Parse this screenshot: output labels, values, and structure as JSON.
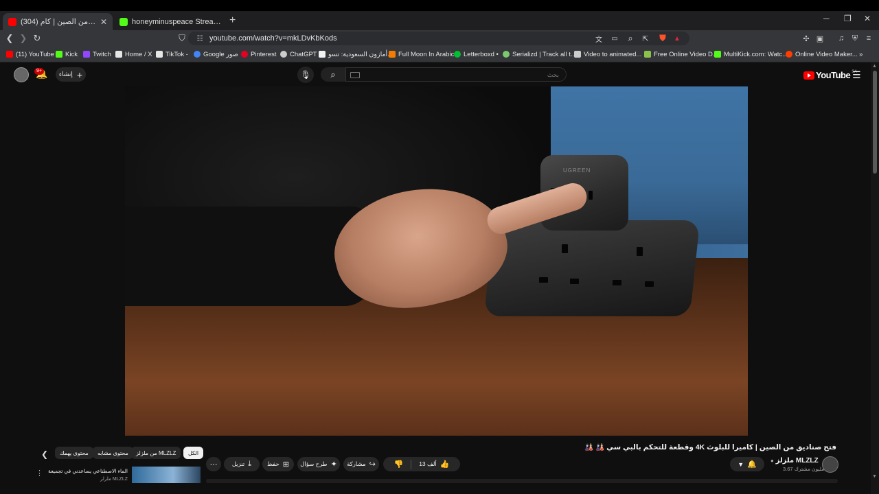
{
  "browser": {
    "tabs": [
      {
        "title": "فتح صناديق من الصين | كام (304)",
        "favicon_color": "#ff0000",
        "active": true
      },
      {
        "title": "honeyminuspeace Stream - Kick Dash",
        "favicon_color": "#53fc18",
        "active": false
      }
    ],
    "new_tab_label": "+",
    "url": "youtube.com/watch?v=mkLDvKbKods",
    "bookmarks": [
      {
        "label": "(11) YouTube",
        "color": "#ff0000"
      },
      {
        "label": "Kick",
        "color": "#53fc18"
      },
      {
        "label": "Twitch",
        "color": "#9146ff"
      },
      {
        "label": "Home / X",
        "color": "#e6e6e6"
      },
      {
        "label": "TikTok -",
        "color": "#e6e6e6"
      },
      {
        "label": "Google صور",
        "color": "#4285f4"
      },
      {
        "label": "Pinterest",
        "color": "#e60023"
      },
      {
        "label": "ChatGPT",
        "color": "#cccccc"
      },
      {
        "label": "أمازون السعودية: تسو...",
        "color": "#f2f2f2"
      },
      {
        "label": "Full Moon In Arabic",
        "color": "#f57c00"
      },
      {
        "label": "Letterboxd •",
        "color": "#00c030"
      },
      {
        "label": "Serializd | Track all t...",
        "color": "#7bc96f"
      },
      {
        "label": "Video to animated...",
        "color": "#cccccc"
      },
      {
        "label": "Free Online Video D...",
        "color": "#8bc34a"
      },
      {
        "label": "MultiKick.com: Watc...",
        "color": "#53fc18"
      },
      {
        "label": "Online Video Maker...",
        "color": "#ff3d00"
      }
    ]
  },
  "yt": {
    "logo_text": "YouTube",
    "logo_region": "SA",
    "search_placeholder": "بحث",
    "create_label": "إنشاء",
    "notif_badge": "9+",
    "video": {
      "title": "فتح صناديق من الصين | كاميرا للبلوث 4K وقطعة للتحكم بالبي سي 🎎 🎎",
      "channel": "ملزلز MLZLZ",
      "subscribers": "3.67 مليون مشترك",
      "like_count": "13 ألف",
      "share_label": "مشاركة",
      "ask_label": "طرح سؤال",
      "save_label": "حفظ",
      "download_label": "تنزيل",
      "brand_on_product": "UGREEN"
    },
    "chips": [
      {
        "label": "الكل",
        "active": true
      },
      {
        "label": "من ملزلز MLZLZ",
        "active": false
      },
      {
        "label": "محتوى مشابه",
        "active": false
      },
      {
        "label": "محتوى يهمك",
        "active": false
      }
    ],
    "recommendation": {
      "title": "الماء الاصطناعي يساعدني في تجميعة",
      "channel": "ملزلز MLZLZ"
    }
  }
}
